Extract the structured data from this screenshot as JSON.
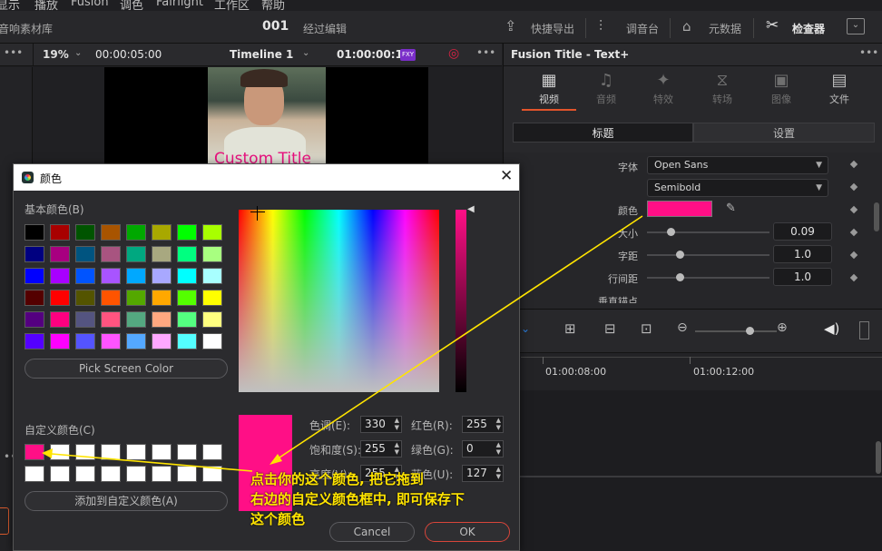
{
  "menubar": {
    "items": [
      "显示",
      "播放",
      "Fusion",
      "调色",
      "Fairlight",
      "工作区",
      "帮助"
    ]
  },
  "toolbar": {
    "left_label": "音响素材库",
    "project_number": "001",
    "project_status": "经过编辑",
    "quick_export": "快捷导出",
    "mixer": "调音台",
    "metadata": "元数据",
    "inspector": "检查器"
  },
  "viewer": {
    "zoom": "19%",
    "source_timecode": "00:00:05:00",
    "timeline_name": "Timeline 1",
    "record_timecode": "01:00:00:14",
    "fx_badge": "FXY",
    "overlay_title": "Custom Title"
  },
  "inspector": {
    "title": "Fusion Title - Text+",
    "tabs": [
      {
        "label": "视频",
        "icon": "film-icon",
        "active": true
      },
      {
        "label": "音频",
        "icon": "music-note-icon",
        "active": false
      },
      {
        "label": "特效",
        "icon": "magic-wand-icon",
        "active": false
      },
      {
        "label": "转场",
        "icon": "transition-icon",
        "active": false
      },
      {
        "label": "图像",
        "icon": "image-icon",
        "active": false
      },
      {
        "label": "文件",
        "icon": "file-icon",
        "active": false
      }
    ],
    "subtabs": {
      "title": "标题",
      "settings": "设置"
    },
    "font_label": "字体",
    "font_value": "Open Sans",
    "weight_value": "Semibold",
    "color_label": "颜色",
    "color_value": "#ff0f86",
    "size_label": "大小",
    "size_value": "0.09",
    "tracking_label": "字距",
    "tracking_value": "1.0",
    "linespacing_label": "行间距",
    "linespacing_value": "1.0",
    "anchor_label": "垂直锚点"
  },
  "timeline": {
    "ruler": [
      "01:00:08:00",
      "01:00:12:00"
    ]
  },
  "dialog": {
    "title": "颜色",
    "basic_colors_label": "基本颜色(B)",
    "basic_colors": [
      "#000000",
      "#a80000",
      "#005400",
      "#a85400",
      "#00a800",
      "#a8a800",
      "#00ff00",
      "#a8ff00",
      "#000080",
      "#a80080",
      "#005480",
      "#a85480",
      "#00a880",
      "#a8a880",
      "#00ff80",
      "#a8ff80",
      "#0000ff",
      "#a800ff",
      "#0054ff",
      "#a854ff",
      "#00a8ff",
      "#a8a8ff",
      "#00ffff",
      "#a8ffff",
      "#540000",
      "#ff0000",
      "#545400",
      "#ff5400",
      "#54a800",
      "#ffa800",
      "#54ff00",
      "#ffff00",
      "#540080",
      "#ff0080",
      "#545480",
      "#ff5480",
      "#54a880",
      "#ffa880",
      "#54ff80",
      "#ffff80",
      "#5400ff",
      "#ff00ff",
      "#5454ff",
      "#ff54ff",
      "#54a8ff",
      "#ffa8ff",
      "#54ffff",
      "#ffffff"
    ],
    "pick_screen_color": "Pick Screen Color",
    "custom_colors_label": "自定义颜色(C)",
    "custom_colors": [
      "#ff0f86",
      "#ffffff",
      "#ffffff",
      "#ffffff",
      "#ffffff",
      "#ffffff",
      "#ffffff",
      "#ffffff",
      "#ffffff",
      "#ffffff",
      "#ffffff",
      "#ffffff",
      "#ffffff",
      "#ffffff",
      "#ffffff",
      "#ffffff"
    ],
    "add_custom": "添加到自定义颜色(A)",
    "preview_color": "#ff0f86",
    "fields": {
      "hue_label": "色调(E):",
      "hue_value": "330",
      "sat_label": "饱和度(S):",
      "sat_value": "255",
      "val_label": "亮度(V):",
      "val_value": "255",
      "red_label": "红色(R):",
      "red_value": "255",
      "green_label": "绿色(G):",
      "green_value": "0",
      "blue_label": "蓝色(U):",
      "blue_value": "127"
    },
    "cancel": "Cancel",
    "ok": "OK"
  },
  "annotation": {
    "line1": "点击你的这个颜色, 把它拖到",
    "line2": "右边的自定义颜色框中, 即可保存下",
    "line3": "这个颜色",
    "color": "#ffe400"
  }
}
